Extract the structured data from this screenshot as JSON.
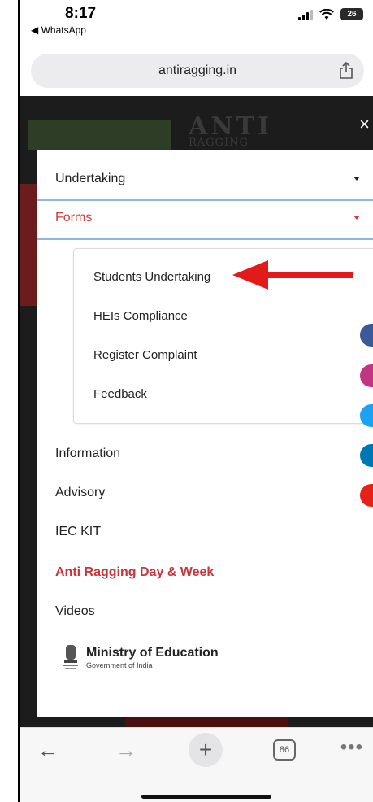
{
  "status_bar": {
    "time": "8:17",
    "back_app": "◀ WhatsApp",
    "battery": "26"
  },
  "browser": {
    "url": "antiragging.in",
    "tab_count": "86"
  },
  "site": {
    "brand": "ANTI",
    "brand_sub": "RAGGING",
    "close_label": "×"
  },
  "menu": {
    "undertaking": "Undertaking",
    "forms": "Forms",
    "forms_items": [
      "Students Undertaking",
      "HEIs Compliance",
      "Register Complaint",
      "Feedback"
    ],
    "information": "Information",
    "advisory": "Advisory",
    "iec_kit": "IEC KIT",
    "anti_ragging_day": "Anti Ragging Day & Week",
    "videos": "Videos"
  },
  "ministry": {
    "title": "Ministry of Education",
    "subtitle": "Government of India"
  },
  "colors": {
    "accent_red": "#d03b3b",
    "separator_blue": "#8fb4e6",
    "arrow_red": "#e31a1a"
  },
  "social_icons": [
    "facebook-icon",
    "instagram-icon",
    "twitter-icon",
    "linkedin-icon",
    "youtube-icon"
  ]
}
